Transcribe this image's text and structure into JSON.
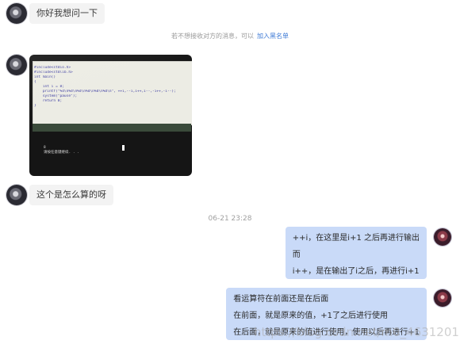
{
  "messages": {
    "msg1": "你好我想问一下",
    "msg2": "这个是怎么算的呀"
  },
  "notice": {
    "text": "若不想接收对方的消息，可以",
    "link": "加入黑名单"
  },
  "photo": {
    "code_lines": [
      "#include<stdio.h>",
      "#include<stdlib.h>",
      "int main()",
      "{",
      "    int i = 8;",
      "    printf(\"%d\\n%d\\n%d\\n%d\\n%d\\n%d\\n\", ++i,--i,i++,i--,-i++,-i--);",
      "    system(\"pause\");",
      "    return 0;",
      "}"
    ],
    "console_lines": [
      "8",
      "请按任意键继续. . ."
    ]
  },
  "timestamp": "06-21 23:28",
  "reply1": {
    "line1": "++i，在这里是i+1 之后再进行输出",
    "line2": "而",
    "line3": "i++，是在输出了i之后，再进行i+1"
  },
  "reply2": {
    "line1": "看运算符在前面还是在后面",
    "line2": "在前面，就是原来的值，+1了之后进行使用",
    "line3": "在后面，就是原来的值进行使用，使用以后再进行+1"
  },
  "watermark": "https://blog.csdn.net/m0_46312017",
  "colors": {
    "reply_bubble": "#c9daf8",
    "incoming_bubble": "#f3f3f3",
    "link": "#3f7bd6"
  }
}
